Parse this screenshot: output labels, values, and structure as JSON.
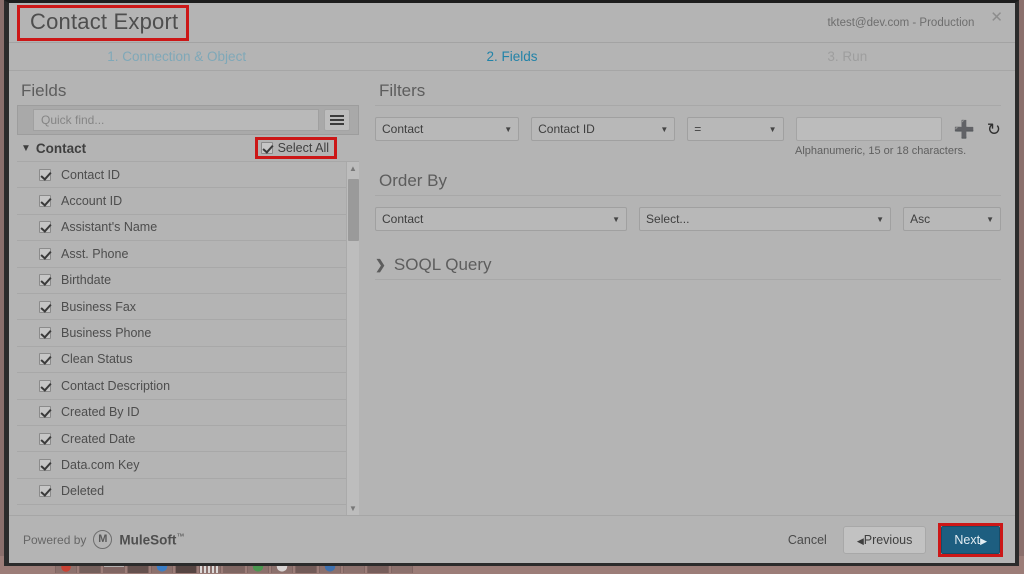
{
  "window": {
    "title": "Contact Export",
    "org_label": "tktest@dev.com - Production",
    "close_icon": "close-icon"
  },
  "steps": [
    {
      "label": "1. Connection & Object",
      "state": "done"
    },
    {
      "label": "2. Fields",
      "state": "active"
    },
    {
      "label": "3. Run",
      "state": "upcoming"
    }
  ],
  "fields_pane": {
    "title": "Fields",
    "quick_find_placeholder": "Quick find...",
    "quick_find_value": "",
    "list_menu_icon": "hamburger-menu-icon",
    "group": {
      "name": "Contact",
      "chevron_icon": "chevron-down-icon",
      "expanded": true
    },
    "select_all": {
      "label": "Select All",
      "checked": true
    },
    "items": [
      {
        "label": "Contact ID",
        "checked": true
      },
      {
        "label": "Account ID",
        "checked": true
      },
      {
        "label": "Assistant's Name",
        "checked": true
      },
      {
        "label": "Asst. Phone",
        "checked": true
      },
      {
        "label": "Birthdate",
        "checked": true
      },
      {
        "label": "Business Fax",
        "checked": true
      },
      {
        "label": "Business Phone",
        "checked": true
      },
      {
        "label": "Clean Status",
        "checked": true
      },
      {
        "label": "Contact Description",
        "checked": true
      },
      {
        "label": "Created By ID",
        "checked": true
      },
      {
        "label": "Created Date",
        "checked": true
      },
      {
        "label": "Data.com Key",
        "checked": true
      },
      {
        "label": "Deleted",
        "checked": true
      }
    ],
    "scrollbar": {
      "up_icon": "caret-up-icon",
      "down_icon": "caret-down-icon"
    }
  },
  "filters": {
    "title": "Filters",
    "object_value": "Contact",
    "field_value": "Contact ID",
    "operator_value": "=",
    "value_input": "",
    "value_placeholder": "",
    "hint": "Alphanumeric, 15 or 18 characters.",
    "add_icon": "plus-icon",
    "refresh_icon": "refresh-icon"
  },
  "order_by": {
    "title": "Order By",
    "object_value": "Contact",
    "field_value": "Select...",
    "direction_value": "Asc"
  },
  "soql": {
    "title": "SOQL Query",
    "chevron_icon": "chevron-right-icon",
    "expanded": false
  },
  "footer": {
    "powered_by": "Powered by",
    "brand_mark": "M",
    "brand_name": "MuleSoft",
    "brand_tm": "™",
    "cancel_label": "Cancel",
    "previous_label": "Previous",
    "previous_icon": "caret-left-icon",
    "next_label": "Next",
    "next_icon": "caret-right-icon"
  },
  "highlight_color": "#cc1717",
  "accent_color": "#1d5e80",
  "active_step_color": "#2283a8"
}
